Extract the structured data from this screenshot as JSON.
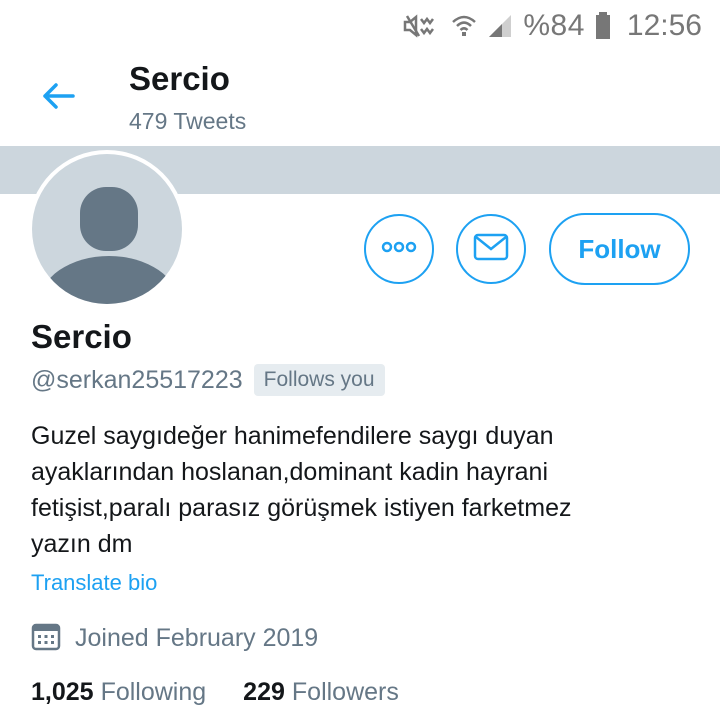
{
  "status_bar": {
    "battery": "%84",
    "time": "12:56"
  },
  "header": {
    "title": "Sercio",
    "tweet_count": "479 Tweets"
  },
  "actions": {
    "follow_label": "Follow"
  },
  "profile": {
    "name": "Sercio",
    "handle": "@serkan25517223",
    "follows_you": "Follows you",
    "bio_lines": [
      "Guzel saygıdeğer hanimefendilere saygı duyan",
      "ayaklarından hoslanan,dominant kadin hayrani",
      "fetişist,paralı parasız görüşmek istiyen farketmez",
      "yazın dm"
    ],
    "translate_label": "Translate bio",
    "joined": "Joined February 2019",
    "following_count": "1,025",
    "following_label": "Following",
    "followers_count": "229",
    "followers_label": "Followers"
  },
  "colors": {
    "accent": "#1da1f2",
    "banner": "#ccd6dd",
    "muted_text": "#657786"
  },
  "icons": {
    "back": "arrow-left-icon",
    "more": "more-dots-icon",
    "message": "envelope-icon",
    "calendar": "calendar-icon",
    "mute": "mute-icon",
    "wifi": "wifi-icon",
    "signal": "signal-icon",
    "battery": "battery-icon"
  }
}
